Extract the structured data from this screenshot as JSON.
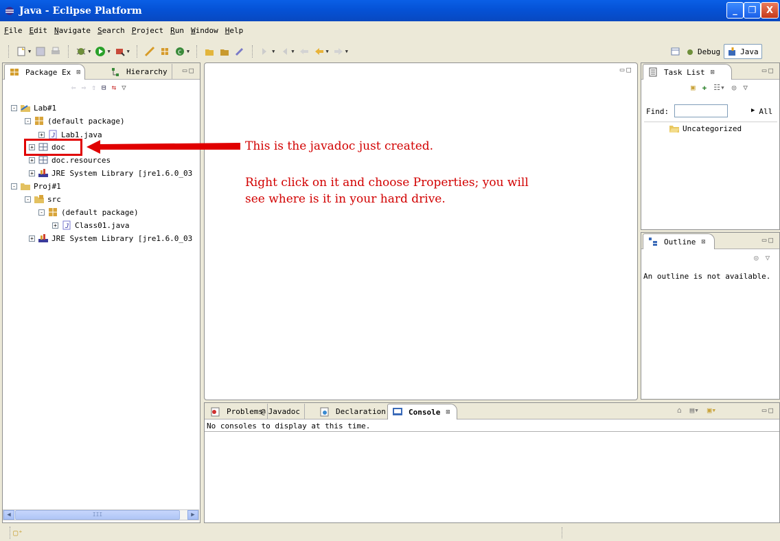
{
  "window": {
    "title": "Java - Eclipse Platform",
    "minimize_glyph": "_",
    "maximize_glyph": "❐",
    "close_glyph": "X"
  },
  "menu": [
    "File",
    "Edit",
    "Navigate",
    "Search",
    "Project",
    "Run",
    "Window",
    "Help"
  ],
  "perspectives": {
    "debug": "Debug",
    "java": "Java"
  },
  "package_explorer": {
    "tabs": [
      {
        "label": "Package Ex",
        "active": true,
        "close": "⊠"
      },
      {
        "label": "Hierarchy",
        "active": false
      }
    ],
    "tree": [
      {
        "label": "Lab#1",
        "icon": "project-icon",
        "toggle": "-"
      },
      {
        "label": "(default package)",
        "icon": "package-icon",
        "toggle": "-"
      },
      {
        "label": "Lab1.java",
        "icon": "java-file-icon",
        "toggle": "+"
      },
      {
        "label": "doc",
        "icon": "folder-icon",
        "toggle": "+"
      },
      {
        "label": "doc.resources",
        "icon": "folder-icon",
        "toggle": "+"
      },
      {
        "label": "JRE System Library [jre1.6.0_03",
        "icon": "library-icon",
        "toggle": "+"
      },
      {
        "label": "Proj#1",
        "icon": "project-icon",
        "toggle": "-"
      },
      {
        "label": "src",
        "icon": "source-folder-icon",
        "toggle": "-"
      },
      {
        "label": "(default package)",
        "icon": "package-icon",
        "toggle": "-"
      },
      {
        "label": "Class01.java",
        "icon": "java-file-icon",
        "toggle": "+"
      },
      {
        "label": "JRE System Library [jre1.6.0_03",
        "icon": "library-icon",
        "toggle": "+"
      }
    ],
    "scroll_thumb": "III"
  },
  "task_list": {
    "tab": "Task List",
    "find_label": "Find:",
    "find_value": "",
    "all_label": "All",
    "category": "Uncategorized"
  },
  "outline": {
    "tab": "Outline",
    "message": "An outline is not available."
  },
  "bottom_tabs": [
    {
      "label": "Problems",
      "active": false,
      "icon": "problems-icon"
    },
    {
      "label": "Javadoc",
      "active": false,
      "icon": "javadoc-icon"
    },
    {
      "label": "Declaration",
      "active": false,
      "icon": "declaration-icon"
    },
    {
      "label": "Console",
      "active": true,
      "icon": "console-icon"
    }
  ],
  "console": {
    "message": "No consoles to display at this time."
  },
  "annotation": {
    "line1": "This is the javadoc just created.",
    "line2": "Right click on it and choose Properties; you will",
    "line3": "see where is it in your hard drive.",
    "color": "#d20000"
  }
}
